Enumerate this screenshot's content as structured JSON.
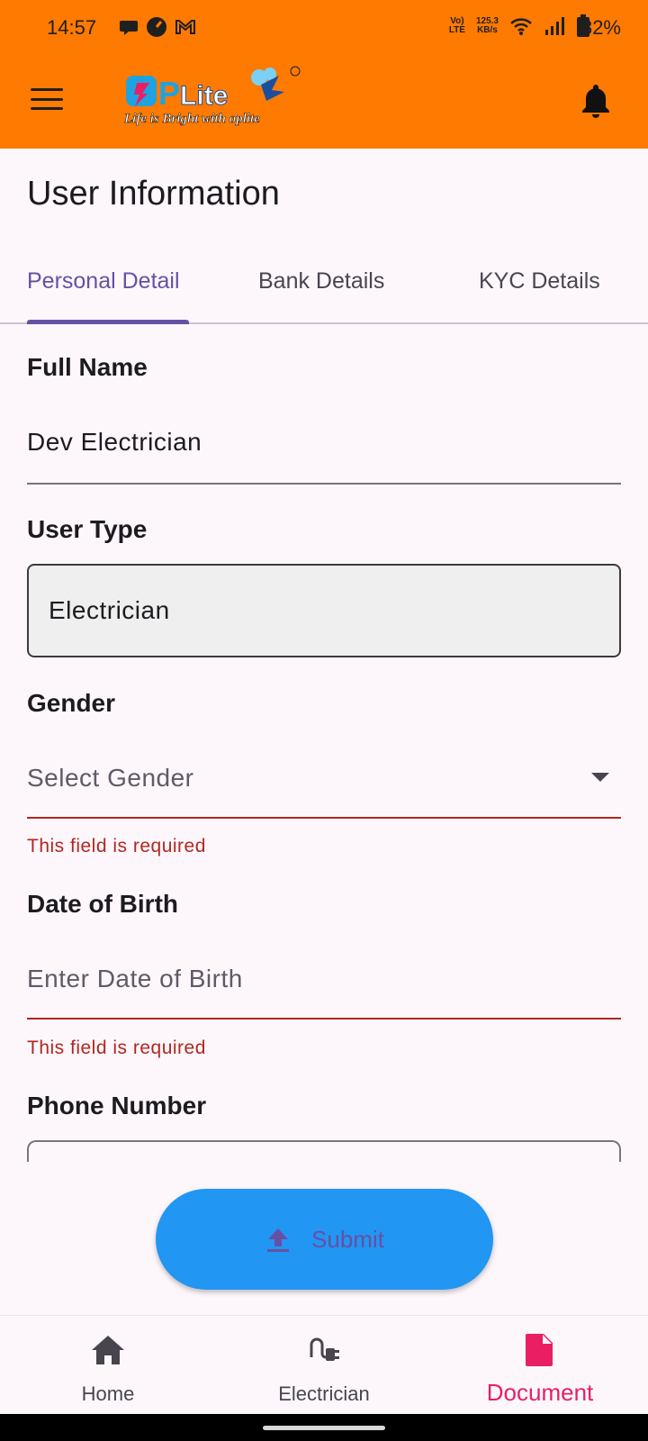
{
  "status_bar": {
    "time": "14:57",
    "net_top": "Vo)",
    "net_bottom": "LTE",
    "speed_top": "125.3",
    "speed_bottom": "KB/s",
    "battery": "82%"
  },
  "app_bar": {
    "logo_text": "OPLite",
    "logo_tagline": "Life is Bright with oplite",
    "colors": {
      "background": "#ff7a00"
    }
  },
  "page": {
    "title": "User Information"
  },
  "tabs": [
    {
      "label": "Personal Detail",
      "active": true
    },
    {
      "label": "Bank Details",
      "active": false
    },
    {
      "label": "KYC Details",
      "active": false
    }
  ],
  "form": {
    "full_name": {
      "label": "Full Name",
      "value": "Dev Electrician"
    },
    "user_type": {
      "label": "User Type",
      "value": "Electrician"
    },
    "gender": {
      "label": "Gender",
      "placeholder": "Select Gender",
      "error": "This field is required"
    },
    "dob": {
      "label": "Date of Birth",
      "placeholder": "Enter Date of Birth",
      "error": "This field is required"
    },
    "phone": {
      "label": "Phone Number"
    }
  },
  "submit": {
    "label": "Submit",
    "icon": "upload-icon",
    "color": "#2196f3"
  },
  "bottom_nav": [
    {
      "label": "Home",
      "icon": "home-icon",
      "active": false
    },
    {
      "label": "Electrician",
      "icon": "plug-icon",
      "active": false
    },
    {
      "label": "Document",
      "icon": "document-icon",
      "active": true,
      "color": "#e91e63"
    }
  ]
}
